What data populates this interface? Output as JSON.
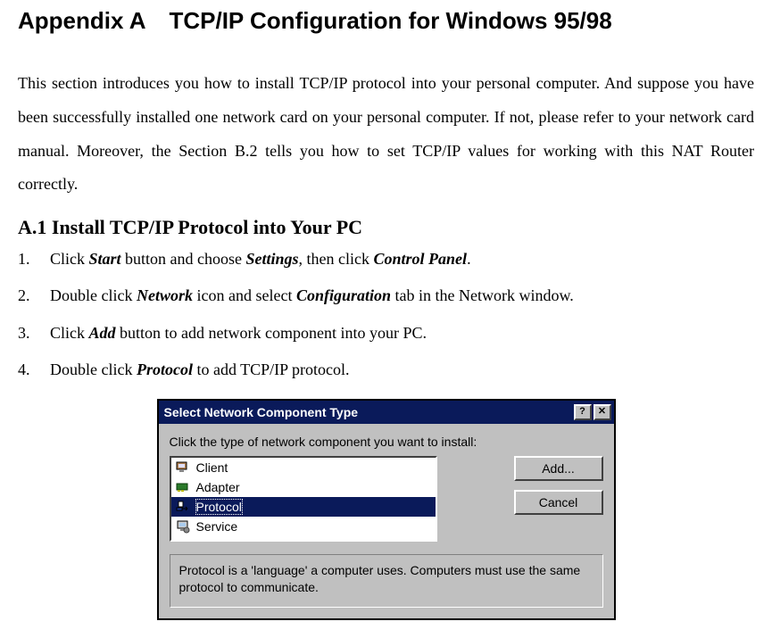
{
  "title": "Appendix A TCP/IP Configuration for Windows 95/98",
  "intro": "This section introduces you how to install TCP/IP protocol into your personal computer. And suppose you have been successfully installed one network card on your personal computer. If not, please refer to your network card manual. Moreover, the Section B.2 tells you how to set TCP/IP values for working with this NAT Router correctly.",
  "section_a1_title": "A.1 Install TCP/IP Protocol into Your PC",
  "steps": {
    "s1": {
      "num": "1.",
      "pre": "Click ",
      "t1": "Start",
      "mid1": " button and choose ",
      "t2": "Settings",
      "mid2": ", then click ",
      "t3": "Control Panel",
      "post": "."
    },
    "s2": {
      "num": "2.",
      "pre": "Double click ",
      "t1": "Network",
      "mid1": " icon and select ",
      "t2": "Configuration",
      "post": " tab in the Network window."
    },
    "s3": {
      "num": "3.",
      "pre": "Click ",
      "t1": "Add",
      "post": " button to add network component into your PC."
    },
    "s4": {
      "num": "4.",
      "pre": "Double click ",
      "t1": "Protocol",
      "post": " to add TCP/IP protocol."
    }
  },
  "dialog": {
    "title": "Select Network Component Type",
    "prompt": "Click the type of network component you want to install:",
    "items": {
      "client": "Client",
      "adapter": "Adapter",
      "protocol": "Protocol",
      "service": "Service"
    },
    "buttons": {
      "add": "Add...",
      "cancel": "Cancel"
    },
    "titlebtns": {
      "help": "?",
      "close": "✕"
    },
    "description": "Protocol is a 'language' a computer uses. Computers must use the same protocol to communicate."
  }
}
